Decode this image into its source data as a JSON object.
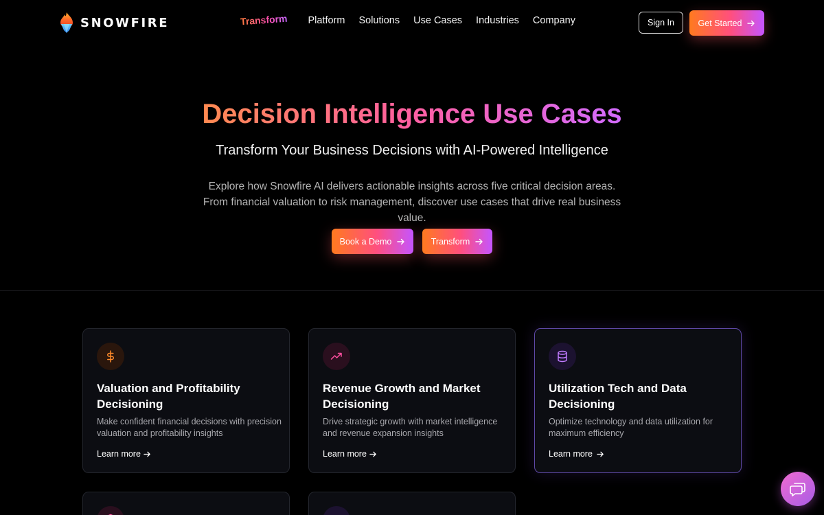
{
  "header": {
    "brand": "SNOWFIRE",
    "nav_transform": "Transform",
    "nav_items": [
      "Platform",
      "Solutions",
      "Use Cases",
      "Industries",
      "Company"
    ],
    "sign_in": "Sign In",
    "get_started": "Get Started"
  },
  "hero": {
    "title": "Decision Intelligence Use Cases",
    "subtitle": "Transform Your Business Decisions with AI-Powered Intelligence",
    "description": "Explore how Snowfire AI delivers actionable insights across five critical decision areas. From financial valuation to risk management, discover use cases that drive real business value.",
    "book_demo": "Book a Demo",
    "transform": "Transform"
  },
  "cards": [
    {
      "icon": "dollar-icon",
      "title": "Valuation and Profitability Decisioning",
      "description": "Make confident financial decisions with precision valuation and profitability insights",
      "link": "Learn more"
    },
    {
      "icon": "trending-up-icon",
      "title": "Revenue Growth and Market Decisioning",
      "description": "Drive strategic growth with market intelligence and revenue expansion insights",
      "link": "Learn more"
    },
    {
      "icon": "database-icon",
      "title": "Utilization Tech and Data Decisioning",
      "description": "Optimize technology and data utilization for maximum efficiency",
      "link": "Learn more"
    }
  ],
  "colors": {
    "accent_orange": "#ff7a1f",
    "accent_pink": "#ff4f7e",
    "accent_purple": "#c555ff",
    "background": "#000000",
    "card_bg": "#0c0d12"
  }
}
